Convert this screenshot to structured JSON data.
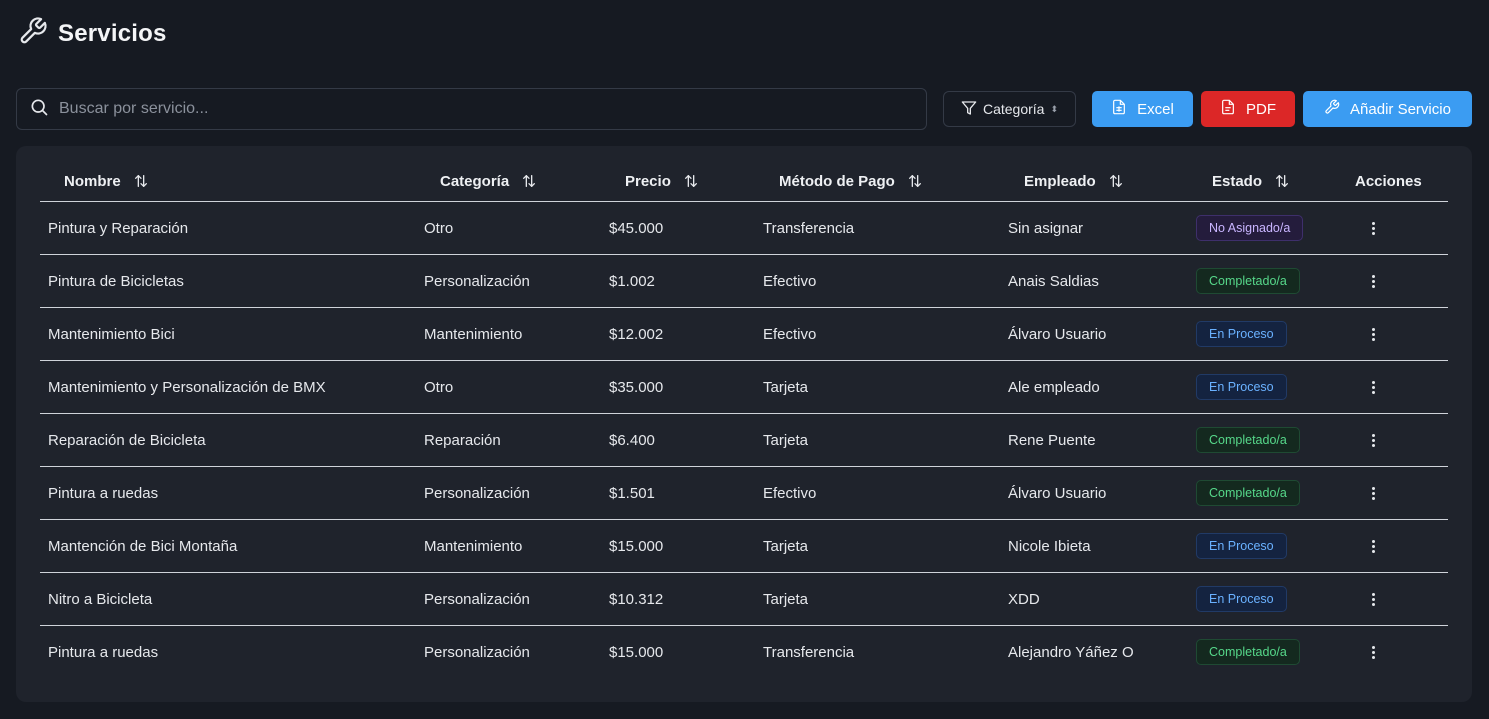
{
  "header": {
    "title": "Servicios",
    "icon": "wrench-icon"
  },
  "search": {
    "placeholder": "Buscar por servicio..."
  },
  "filter": {
    "label": "Categoría"
  },
  "actions": {
    "excel_label": "Excel",
    "pdf_label": "PDF",
    "add_label": "Añadir Servicio"
  },
  "colors": {
    "background": "#161a22",
    "card": "#1f232c",
    "primary": "#3b9cf2",
    "danger": "#dc2727"
  },
  "table": {
    "columns": [
      "Nombre",
      "Categoría",
      "Precio",
      "Método de Pago",
      "Empleado",
      "Estado",
      "Acciones"
    ],
    "rows": [
      {
        "nombre": "Pintura y Reparación",
        "categoria": "Otro",
        "precio": "$45.000",
        "metodo": "Transferencia",
        "empleado": "Sin asignar",
        "estado": "No Asignado/a",
        "estado_tipo": "unassigned"
      },
      {
        "nombre": "Pintura de Bicicletas",
        "categoria": "Personalización",
        "precio": "$1.002",
        "metodo": "Efectivo",
        "empleado": "Anais Saldias",
        "estado": "Completado/a",
        "estado_tipo": "done"
      },
      {
        "nombre": "Mantenimiento Bici",
        "categoria": "Mantenimiento",
        "precio": "$12.002",
        "metodo": "Efectivo",
        "empleado": "Álvaro Usuario",
        "estado": "En Proceso",
        "estado_tipo": "progress"
      },
      {
        "nombre": "Mantenimiento y Personalización de BMX",
        "categoria": "Otro",
        "precio": "$35.000",
        "metodo": "Tarjeta",
        "empleado": "Ale empleado",
        "estado": "En Proceso",
        "estado_tipo": "progress"
      },
      {
        "nombre": "Reparación de Bicicleta",
        "categoria": "Reparación",
        "precio": "$6.400",
        "metodo": "Tarjeta",
        "empleado": "Rene Puente",
        "estado": "Completado/a",
        "estado_tipo": "done"
      },
      {
        "nombre": "Pintura a ruedas",
        "categoria": "Personalización",
        "precio": "$1.501",
        "metodo": "Efectivo",
        "empleado": "Álvaro Usuario",
        "estado": "Completado/a",
        "estado_tipo": "done"
      },
      {
        "nombre": "Mantención de Bici Montaña",
        "categoria": "Mantenimiento",
        "precio": "$15.000",
        "metodo": "Tarjeta",
        "empleado": "Nicole Ibieta",
        "estado": "En Proceso",
        "estado_tipo": "progress"
      },
      {
        "nombre": "Nitro a Bicicleta",
        "categoria": "Personalización",
        "precio": "$10.312",
        "metodo": "Tarjeta",
        "empleado": "XDD",
        "estado": "En Proceso",
        "estado_tipo": "progress"
      },
      {
        "nombre": "Pintura a ruedas",
        "categoria": "Personalización",
        "precio": "$15.000",
        "metodo": "Transferencia",
        "empleado": "Alejandro Yáñez O",
        "estado": "Completado/a",
        "estado_tipo": "done"
      }
    ]
  }
}
